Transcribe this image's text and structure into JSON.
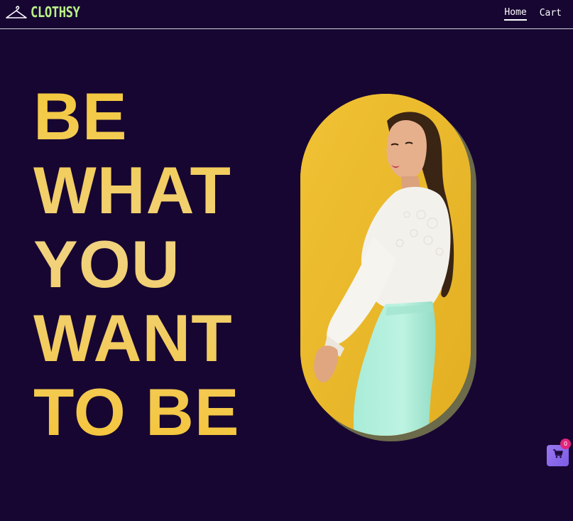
{
  "header": {
    "brand": "CLOTHSY",
    "brand_icon": "hanger-icon",
    "nav": [
      {
        "label": "Home",
        "active": true
      },
      {
        "label": "Cart",
        "active": false
      }
    ]
  },
  "hero": {
    "headline_lines": [
      "BE",
      "WHAT",
      "YOU",
      "WANT",
      "TO BE"
    ],
    "image_subject": "woman in white lace blouse and mint skirt on yellow background"
  },
  "cart_fab": {
    "icon": "shopping-cart-icon",
    "count": "0"
  },
  "colors": {
    "background": "#170632",
    "brand_green": "#b9f087",
    "headline_yellow": "#f4c83a",
    "image_bg": "#e9b92b",
    "fab_purple": "#8a68ea",
    "badge_pink": "#e2247c"
  }
}
